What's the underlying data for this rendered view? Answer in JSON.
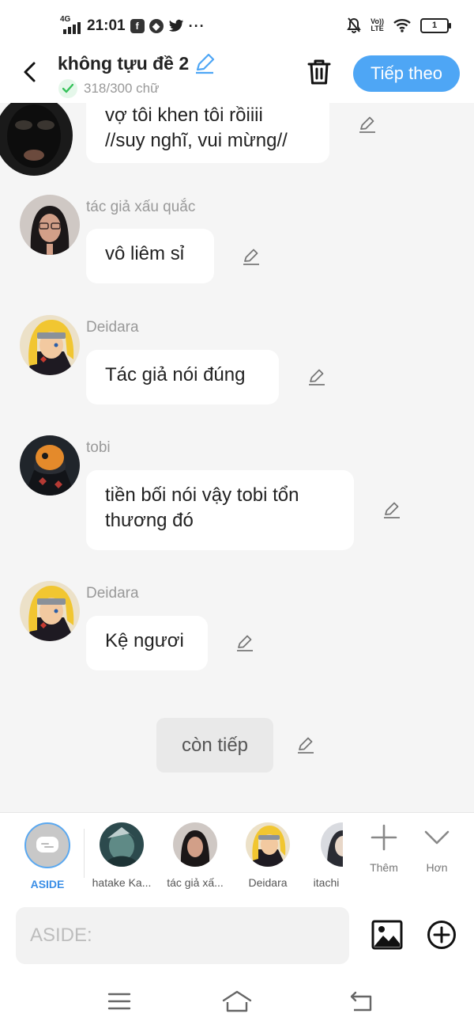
{
  "status_bar": {
    "network": "4G",
    "time": "21:01",
    "volte_line1": "Vo))",
    "volte_line2": "LTE",
    "battery": "1"
  },
  "header": {
    "title": "không tựu đề 2",
    "word_count": "318/300 chữ",
    "next_label": "Tiếp theo"
  },
  "messages": [
    {
      "sender": "",
      "text": "vợ tôi khen tôi rồiiii\n//suy nghĩ, vui mừng//"
    },
    {
      "sender": "tác giả xấu quắc",
      "text": "vô liêm sỉ"
    },
    {
      "sender": "Deidara",
      "text": "Tác giả nói đúng"
    },
    {
      "sender": "tobi",
      "text": "tiền bối nói vậy tobi tổn\nthương đó"
    },
    {
      "sender": "Deidara",
      "text": "Kệ ngươi"
    }
  ],
  "continue_label": "còn tiếp",
  "characters": [
    {
      "name": "ASIDE",
      "selected": true,
      "color": "#3a8ee6"
    },
    {
      "name": "hatake Ka..."
    },
    {
      "name": "tác giả xấ..."
    },
    {
      "name": "Deidara"
    },
    {
      "name": "itachi"
    }
  ],
  "actions": {
    "add_label": "Thêm",
    "more_label": "Hơn"
  },
  "input": {
    "placeholder": "ASIDE:"
  },
  "colors": {
    "accent": "#4ea6f5",
    "selected_text": "#3a8ee6",
    "background": "#f5f5f5"
  },
  "icons": [
    "back-arrow-icon",
    "edit-pencil-icon",
    "verified-check-icon",
    "trash-icon",
    "image-icon",
    "add-circle-icon",
    "menu-icon",
    "home-icon",
    "back-nav-icon"
  ]
}
